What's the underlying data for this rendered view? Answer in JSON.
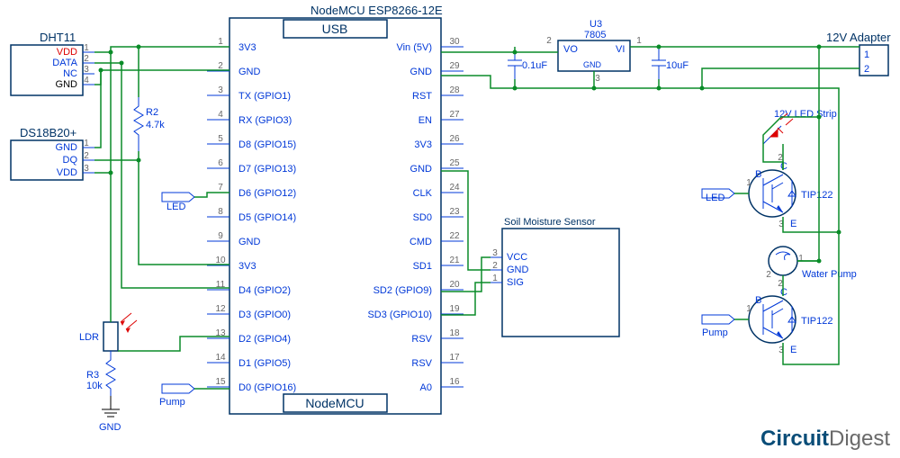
{
  "watermark": "CircuitDigest",
  "mcu": {
    "name": "NodeMCU ESP8266-12E",
    "usb": "USB",
    "footer": "NodeMCU",
    "left_pins": [
      {
        "n": "1",
        "lbl": "3V3"
      },
      {
        "n": "2",
        "lbl": "GND"
      },
      {
        "n": "3",
        "lbl": "TX (GPIO1)"
      },
      {
        "n": "4",
        "lbl": "RX (GPIO3)"
      },
      {
        "n": "5",
        "lbl": "D8 (GPIO15)"
      },
      {
        "n": "6",
        "lbl": "D7 (GPIO13)"
      },
      {
        "n": "7",
        "lbl": "D6 (GPIO12)"
      },
      {
        "n": "8",
        "lbl": "D5 (GPIO14)"
      },
      {
        "n": "9",
        "lbl": "GND"
      },
      {
        "n": "10",
        "lbl": "3V3"
      },
      {
        "n": "11",
        "lbl": "D4 (GPIO2)"
      },
      {
        "n": "12",
        "lbl": "D3 (GPIO0)"
      },
      {
        "n": "13",
        "lbl": "D2 (GPIO4)"
      },
      {
        "n": "14",
        "lbl": "D1 (GPIO5)"
      },
      {
        "n": "15",
        "lbl": "D0 (GPIO16)"
      }
    ],
    "right_pins": [
      {
        "n": "30",
        "lbl": "Vin (5V)"
      },
      {
        "n": "29",
        "lbl": "GND"
      },
      {
        "n": "28",
        "lbl": "RST"
      },
      {
        "n": "27",
        "lbl": "EN"
      },
      {
        "n": "26",
        "lbl": "3V3"
      },
      {
        "n": "25",
        "lbl": "GND"
      },
      {
        "n": "24",
        "lbl": "CLK"
      },
      {
        "n": "23",
        "lbl": "SD0"
      },
      {
        "n": "22",
        "lbl": "CMD"
      },
      {
        "n": "21",
        "lbl": "SD1"
      },
      {
        "n": "20",
        "lbl": "SD2 (GPIO9)"
      },
      {
        "n": "19",
        "lbl": "SD3 (GPIO10)"
      },
      {
        "n": "18",
        "lbl": "RSV"
      },
      {
        "n": "17",
        "lbl": "RSV"
      },
      {
        "n": "16",
        "lbl": "A0"
      }
    ]
  },
  "dht11": {
    "name": "DHT11",
    "pins": [
      {
        "n": "1",
        "lbl": "VDD",
        "cls": "red"
      },
      {
        "n": "2",
        "lbl": "DATA",
        "cls": "blue"
      },
      {
        "n": "3",
        "lbl": "NC",
        "cls": "blue"
      },
      {
        "n": "4",
        "lbl": "GND",
        "cls": "black"
      }
    ]
  },
  "ds18b20": {
    "name": "DS18B20+",
    "pins": [
      {
        "n": "1",
        "lbl": "GND"
      },
      {
        "n": "2",
        "lbl": "DQ"
      },
      {
        "n": "3",
        "lbl": "VDD"
      }
    ]
  },
  "ldr": {
    "name": "LDR",
    "r": "R3",
    "rval": "10k",
    "gnd": "GND"
  },
  "r2": {
    "name": "R2",
    "val": "4.7k"
  },
  "net_led": {
    "name": "LED"
  },
  "net_pump": {
    "name": "Pump"
  },
  "u3": {
    "ref": "U3",
    "part": "7805",
    "vo": "VO",
    "vi": "VI",
    "gnd": "GND"
  },
  "caps": {
    "c1": "0.1uF",
    "c2": "10uF"
  },
  "adapter": {
    "name": "12V Adapter",
    "p1": "1",
    "p2": "2"
  },
  "led_strip": "12V LED Strip",
  "soil": {
    "name": "Soil Moisture Sensor",
    "pins": [
      {
        "n": "3",
        "lbl": "VCC"
      },
      {
        "n": "2",
        "lbl": "GND"
      },
      {
        "n": "1",
        "lbl": "SIG"
      }
    ]
  },
  "tip": {
    "part": "TIP122",
    "b": "B",
    "c": "C",
    "e": "E"
  },
  "pump": "Water Pump",
  "drv_led": "LED",
  "drv_pump": "Pump",
  "u3_pins": {
    "p1": "1",
    "p2": "2",
    "p3": "3"
  }
}
